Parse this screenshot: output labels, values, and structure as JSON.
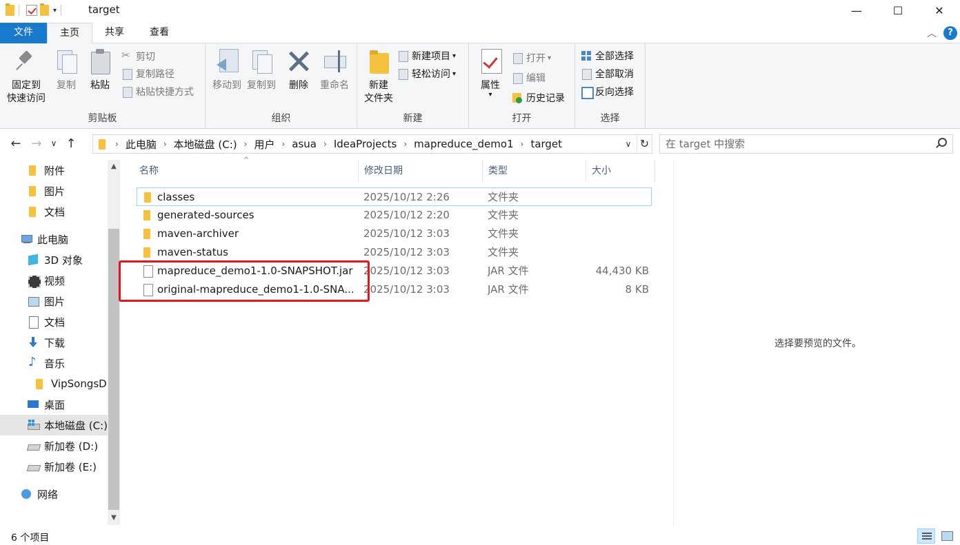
{
  "window": {
    "title": "target",
    "controls": {
      "minimize": "—",
      "maximize": "☐",
      "close": "✕"
    }
  },
  "ribbon": {
    "tabs": {
      "file": "文件",
      "home": "主页",
      "share": "共享",
      "view": "查看"
    },
    "help": "?",
    "clipboard": {
      "label": "剪贴板",
      "pin_line1": "固定到",
      "pin_line2": "快速访问",
      "copy": "复制",
      "paste": "粘贴",
      "cut": "剪切",
      "copy_path": "复制路径",
      "paste_shortcut": "粘贴快捷方式"
    },
    "organize": {
      "label": "组织",
      "move_to": "移动到",
      "copy_to": "复制到",
      "delete": "删除",
      "rename": "重命名"
    },
    "new": {
      "label": "新建",
      "new_folder_line1": "新建",
      "new_folder_line2": "文件夹",
      "new_item": "新建项目",
      "easy_access": "轻松访问"
    },
    "open": {
      "label": "打开",
      "properties": "属性",
      "open": "打开",
      "edit": "编辑",
      "history": "历史记录"
    },
    "select": {
      "label": "选择",
      "select_all": "全部选择",
      "select_none": "全部取消",
      "invert": "反向选择"
    }
  },
  "address": {
    "crumbs": [
      "此电脑",
      "本地磁盘 (C:)",
      "用户",
      "asua",
      "IdeaProjects",
      "mapreduce_demo1",
      "target"
    ]
  },
  "search": {
    "placeholder": "在 target 中搜索"
  },
  "sidebar": {
    "items": [
      {
        "label": "附件",
        "icon": "folder-icon"
      },
      {
        "label": "图片",
        "icon": "folder-icon"
      },
      {
        "label": "文档",
        "icon": "folder-icon"
      },
      {
        "label": "此电脑",
        "icon": "this-pc-icon"
      },
      {
        "label": "3D 对象",
        "icon": "3d-objects-icon"
      },
      {
        "label": "视频",
        "icon": "video-icon"
      },
      {
        "label": "图片",
        "icon": "pictures-icon"
      },
      {
        "label": "文档",
        "icon": "documents-icon"
      },
      {
        "label": "下载",
        "icon": "downloads-icon"
      },
      {
        "label": "音乐",
        "icon": "music-icon"
      },
      {
        "label": "VipSongsD",
        "icon": "folder-icon"
      },
      {
        "label": "桌面",
        "icon": "desktop-icon"
      },
      {
        "label": "本地磁盘 (C:)",
        "icon": "c-drive-icon"
      },
      {
        "label": "新加卷 (D:)",
        "icon": "drive-icon"
      },
      {
        "label": "新加卷 (E:)",
        "icon": "drive-icon"
      },
      {
        "label": "网络",
        "icon": "network-icon"
      }
    ]
  },
  "columns": {
    "name": "名称",
    "date": "修改日期",
    "type": "类型",
    "size": "大小"
  },
  "files": [
    {
      "name": "classes",
      "date": "2025/10/12 2:26",
      "type": "文件夹",
      "size": "",
      "kind": "folder"
    },
    {
      "name": "generated-sources",
      "date": "2025/10/12 2:20",
      "type": "文件夹",
      "size": "",
      "kind": "folder"
    },
    {
      "name": "maven-archiver",
      "date": "2025/10/12 3:03",
      "type": "文件夹",
      "size": "",
      "kind": "folder"
    },
    {
      "name": "maven-status",
      "date": "2025/10/12 3:03",
      "type": "文件夹",
      "size": "",
      "kind": "folder"
    },
    {
      "name": "mapreduce_demo1-1.0-SNAPSHOT.jar",
      "date": "2025/10/12 3:03",
      "type": "JAR 文件",
      "size": "44,430 KB",
      "kind": "file"
    },
    {
      "name": "original-mapreduce_demo1-1.0-SNA...",
      "date": "2025/10/12 3:03",
      "type": "JAR 文件",
      "size": "8 KB",
      "kind": "file"
    }
  ],
  "preview": {
    "text": "选择要预览的文件。"
  },
  "status": {
    "count": "6 个项目"
  },
  "colors": {
    "accent": "#1979ca",
    "highlight": "#e3161f",
    "folder": "#f6c23e"
  }
}
